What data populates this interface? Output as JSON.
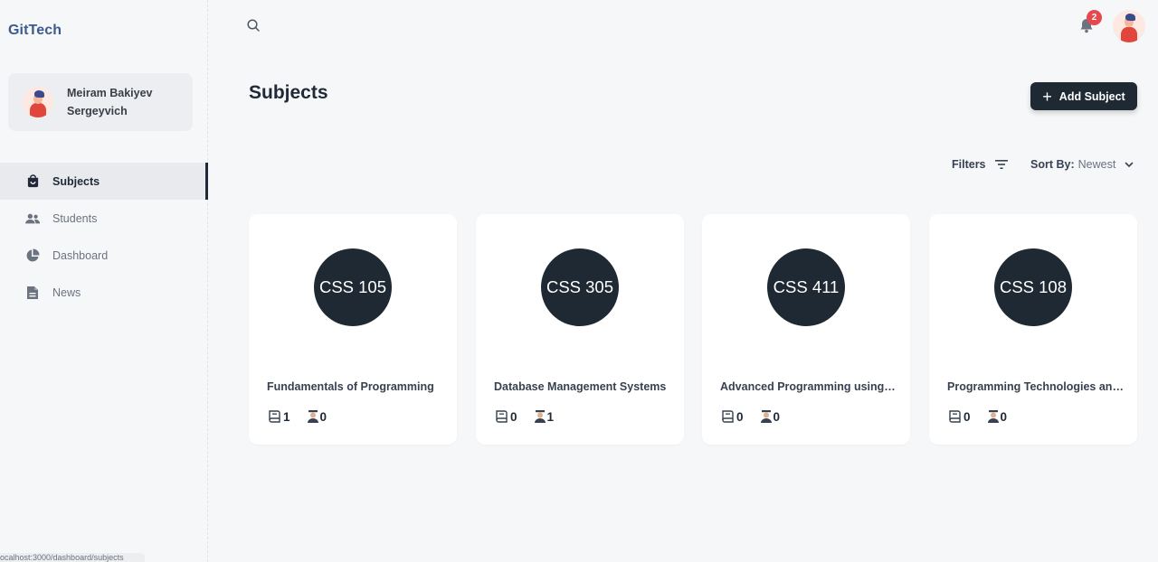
{
  "app": {
    "title": "GitTech"
  },
  "profile": {
    "first_line": "Meiram Bakiyev",
    "second_line": "Sergeyvich"
  },
  "nav": {
    "items": [
      {
        "label": "Subjects",
        "icon": "bag-icon",
        "active": true
      },
      {
        "label": "Students",
        "icon": "users-icon"
      },
      {
        "label": "Dashboard",
        "icon": "pie-chart-icon"
      },
      {
        "label": "News",
        "icon": "document-icon"
      }
    ]
  },
  "header": {
    "notification_count": "2"
  },
  "page": {
    "title": "Subjects",
    "add_button_label": "Add Subject",
    "filters_label": "Filters",
    "sort_label": "Sort By:",
    "sort_value": "Newest"
  },
  "subjects": [
    {
      "code": "CSS 105",
      "name": "Fundamentals of Programming",
      "books": "1",
      "teachers": "0"
    },
    {
      "code": "CSS 305",
      "name": "Database Management Systems",
      "books": "0",
      "teachers": "1"
    },
    {
      "code": "CSS 411",
      "name": "Advanced Programming using Java",
      "books": "0",
      "teachers": "0"
    },
    {
      "code": "CSS 108",
      "name": "Programming Technologies and Tools",
      "books": "0",
      "teachers": "0"
    }
  ],
  "status_bar": {
    "url": "ocalhost:3000/dashboard/subjects"
  },
  "colors": {
    "accent": "#1f2933",
    "logo": "#3b5b8c",
    "badge": "#e5484d"
  }
}
